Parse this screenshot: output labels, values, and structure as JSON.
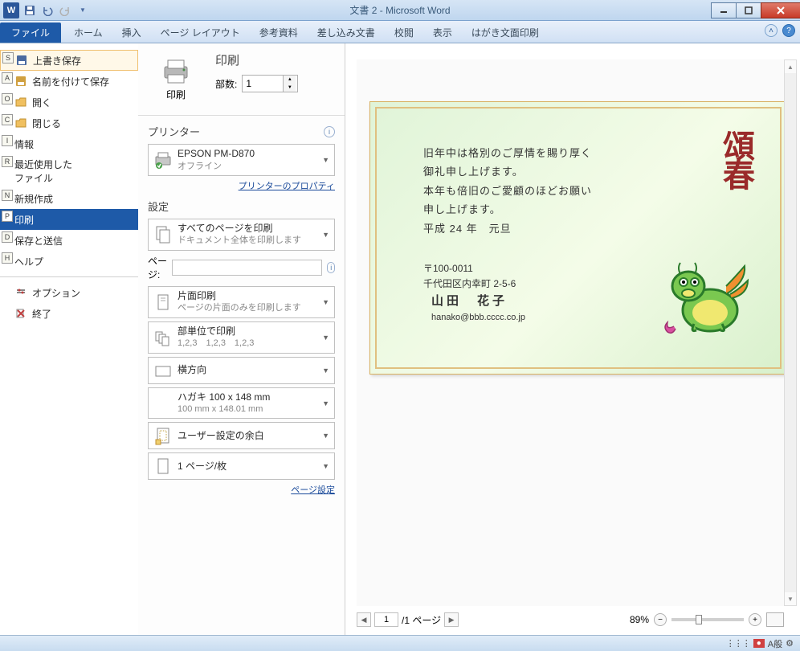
{
  "window": {
    "title": "文書 2 - Microsoft Word"
  },
  "tabs": {
    "file": "ファイル",
    "home": "ホーム",
    "insert": "挿入",
    "layout": "ページ レイアウト",
    "refs": "参考資料",
    "mail": "差し込み文書",
    "review": "校閲",
    "view": "表示",
    "postcard": "はがき文面印刷"
  },
  "backstage": {
    "save": "上書き保存",
    "saveas": "名前を付けて保存",
    "open": "開く",
    "close": "閉じる",
    "info": "情報",
    "recent": "最近使用した\nファイル",
    "new": "新規作成",
    "print": "印刷",
    "share": "保存と送信",
    "help": "ヘルプ",
    "options": "オプション",
    "exit": "終了",
    "keys": {
      "save": "S",
      "saveas": "A",
      "open": "O",
      "close": "C",
      "info": "I",
      "recent": "R",
      "new": "N",
      "print": "P",
      "share": "D",
      "help": "H"
    }
  },
  "print": {
    "heading": "印刷",
    "btn": "印刷",
    "copies_label": "部数:",
    "copies": "1",
    "printer_heading": "プリンター",
    "printer_name": "EPSON PM-D870",
    "printer_status": "オフライン",
    "printer_props": "プリンターのプロパティ",
    "settings_heading": "設定",
    "scope_primary": "すべてのページを印刷",
    "scope_secondary": "ドキュメント全体を印刷します",
    "pages_label": "ページ:",
    "side_primary": "片面印刷",
    "side_secondary": "ページの片面のみを印刷します",
    "collate_primary": "部単位で印刷",
    "collate_secondary": "1,2,3　1,2,3　1,2,3",
    "orient": "横方向",
    "size_primary": "ハガキ 100 x 148 mm",
    "size_secondary": "100 mm x 148.01 mm",
    "margins": "ユーザー設定の余白",
    "sheets": "1 ページ/枚",
    "page_setup": "ページ設定"
  },
  "preview": {
    "greeting_l1": "旧年中は格別のご厚情を賜り厚く",
    "greeting_l2": "御礼申し上げます。",
    "greeting_l3": "本年も倍旧のご愛顧のほどお願い",
    "greeting_l4": "申し上げます。",
    "greeting_l5": "平成 24 年　元旦",
    "postal": "〒100-0011",
    "addr": "千代田区内幸町 2-5-6",
    "name": "山田　花子",
    "email": "hanako@bbb.cccc.co.jp",
    "headline": "頌春"
  },
  "footer": {
    "page": "1",
    "page_total": "/1 ページ",
    "zoom": "89%"
  },
  "status": {
    "ime": "A般"
  }
}
